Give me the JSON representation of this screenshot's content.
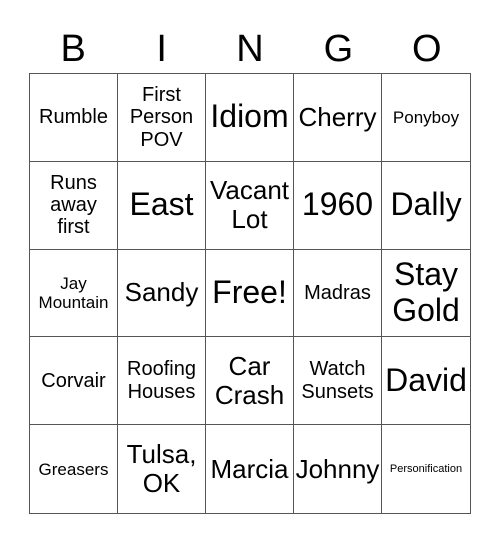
{
  "header": [
    "B",
    "I",
    "N",
    "G",
    "O"
  ],
  "cells": [
    {
      "text": "Rumble",
      "size": "m"
    },
    {
      "text": "First Person POV",
      "size": "m"
    },
    {
      "text": "Idiom",
      "size": "xl"
    },
    {
      "text": "Cherry",
      "size": "l"
    },
    {
      "text": "Ponyboy",
      "size": "s"
    },
    {
      "text": "Runs away first",
      "size": "m"
    },
    {
      "text": "East",
      "size": "xl"
    },
    {
      "text": "Vacant Lot",
      "size": "l"
    },
    {
      "text": "1960",
      "size": "xl"
    },
    {
      "text": "Dally",
      "size": "xl"
    },
    {
      "text": "Jay Mountain",
      "size": "s"
    },
    {
      "text": "Sandy",
      "size": "l"
    },
    {
      "text": "Free!",
      "size": "xl"
    },
    {
      "text": "Madras",
      "size": "m"
    },
    {
      "text": "Stay Gold",
      "size": "xl"
    },
    {
      "text": "Corvair",
      "size": "m"
    },
    {
      "text": "Roofing Houses",
      "size": "m"
    },
    {
      "text": "Car Crash",
      "size": "l"
    },
    {
      "text": "Watch Sunsets",
      "size": "m"
    },
    {
      "text": "David",
      "size": "xl"
    },
    {
      "text": "Greasers",
      "size": "s"
    },
    {
      "text": "Tulsa, OK",
      "size": "l"
    },
    {
      "text": "Marcia",
      "size": "l"
    },
    {
      "text": "Johnny",
      "size": "l"
    },
    {
      "text": "Personification",
      "size": "xs"
    }
  ]
}
